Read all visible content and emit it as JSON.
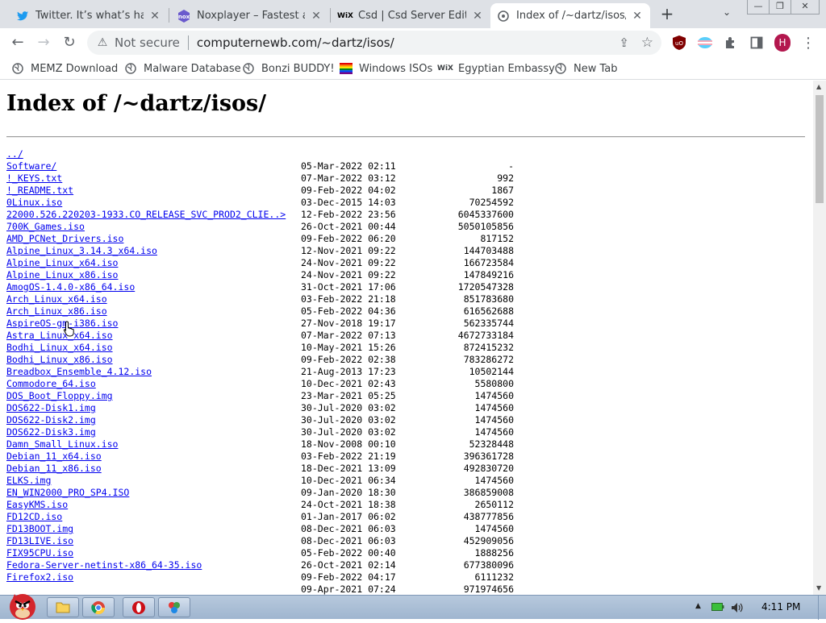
{
  "window": {
    "min_label": "—",
    "max_label": "❐",
    "close_label": "✕"
  },
  "tabs": [
    {
      "label": "Twitter. It’s what’s happening",
      "icon": "twitter-bird-icon",
      "close": "✕"
    },
    {
      "label": "Noxplayer – Fastest and",
      "icon": "noxplayer-icon",
      "close": "✕"
    },
    {
      "label": "Csd | Csd Server Edition",
      "icon": "wix-icon",
      "close": "✕"
    },
    {
      "label": "Index of /~dartz/isos/",
      "icon": "page-icon",
      "close": "✕"
    }
  ],
  "tabstrip": {
    "new_tab": "+",
    "menu": "⌄"
  },
  "toolbar": {
    "back": "←",
    "forward": "→",
    "reload": "↻",
    "security_icon": "⚠",
    "security_text": "Not secure",
    "url": "computernewb.com/~dartz/isos/",
    "share": "⇪",
    "star": "☆",
    "profile_letter": "H",
    "menu": "⋮"
  },
  "bookmarks": [
    {
      "label": "MEMZ Download",
      "icon": "globe-icon"
    },
    {
      "label": "Malware Database",
      "icon": "globe-icon"
    },
    {
      "label": "Bonzi BUDDY!",
      "icon": "globe-icon"
    },
    {
      "label": "Windows ISOs",
      "icon": "rainbow-flag-icon"
    },
    {
      "label": "Egyptian Embassy",
      "icon": "wix-icon"
    },
    {
      "label": "New Tab",
      "icon": "globe-icon"
    }
  ],
  "page": {
    "title": "Index of /~dartz/isos/",
    "entries": [
      {
        "name": "../",
        "date": "",
        "size": ""
      },
      {
        "name": "Software/",
        "date": "05-Mar-2022 02:11",
        "size": "-"
      },
      {
        "name": "!_KEYS.txt",
        "date": "07-Mar-2022 03:12",
        "size": "992"
      },
      {
        "name": "!_README.txt",
        "date": "09-Feb-2022 04:02",
        "size": "1867"
      },
      {
        "name": "0Linux.iso",
        "date": "03-Dec-2015 14:03",
        "size": "70254592"
      },
      {
        "name": "22000.526.220203-1933.CO_RELEASE_SVC_PROD2_CLIE..>",
        "date": "12-Feb-2022 23:56",
        "size": "6045337600"
      },
      {
        "name": "700K_Games.iso",
        "date": "26-Oct-2021 00:44",
        "size": "5050105856"
      },
      {
        "name": "AMD_PCNet_Drivers.iso",
        "date": "09-Feb-2022 06:20",
        "size": "817152"
      },
      {
        "name": "Alpine_Linux_3.14.3_x64.iso",
        "date": "12-Nov-2021 09:22",
        "size": "144703488"
      },
      {
        "name": "Alpine_Linux_x64.iso",
        "date": "24-Nov-2021 09:22",
        "size": "166723584"
      },
      {
        "name": "Alpine_Linux_x86.iso",
        "date": "24-Nov-2021 09:22",
        "size": "147849216"
      },
      {
        "name": "AmogOS-1.4.0-x86_64.iso",
        "date": "31-Oct-2021 17:06",
        "size": "1720547328"
      },
      {
        "name": "Arch_Linux_x64.iso",
        "date": "03-Feb-2022 21:18",
        "size": "851783680"
      },
      {
        "name": "Arch_Linux_x86.iso",
        "date": "05-Feb-2022 04:36",
        "size": "616562688"
      },
      {
        "name": "AspireOS-gm-i386.iso",
        "date": "27-Nov-2018 19:17",
        "size": "562335744"
      },
      {
        "name": "Astra_Linux_x64.iso",
        "date": "07-Mar-2022 07:13",
        "size": "4672733184"
      },
      {
        "name": "Bodhi_Linux_x64.iso",
        "date": "10-May-2021 15:26",
        "size": "872415232"
      },
      {
        "name": "Bodhi_Linux_x86.iso",
        "date": "09-Feb-2022 02:38",
        "size": "783286272"
      },
      {
        "name": "Breadbox_Ensemble_4.12.iso",
        "date": "21-Aug-2013 17:23",
        "size": "10502144"
      },
      {
        "name": "Commodore_64.iso",
        "date": "10-Dec-2021 02:43",
        "size": "5580800"
      },
      {
        "name": "DOS_Boot_Floppy.img",
        "date": "23-Mar-2021 05:25",
        "size": "1474560"
      },
      {
        "name": "DOS622-Disk1.img",
        "date": "30-Jul-2020 03:02",
        "size": "1474560"
      },
      {
        "name": "DOS622-Disk2.img",
        "date": "30-Jul-2020 03:02",
        "size": "1474560"
      },
      {
        "name": "DOS622-Disk3.img",
        "date": "30-Jul-2020 03:02",
        "size": "1474560"
      },
      {
        "name": "Damn_Small_Linux.iso",
        "date": "18-Nov-2008 00:10",
        "size": "52328448"
      },
      {
        "name": "Debian_11_x64.iso",
        "date": "03-Feb-2022 21:19",
        "size": "396361728"
      },
      {
        "name": "Debian_11_x86.iso",
        "date": "18-Dec-2021 13:09",
        "size": "492830720"
      },
      {
        "name": "ELKS.img",
        "date": "10-Dec-2021 06:34",
        "size": "1474560"
      },
      {
        "name": "EN_WIN2000_PRO_SP4.ISO",
        "date": "09-Jan-2020 18:30",
        "size": "386859008"
      },
      {
        "name": "EasyKMS.iso",
        "date": "24-Oct-2021 18:38",
        "size": "2650112"
      },
      {
        "name": "FD12CD.iso",
        "date": "01-Jan-2017 06:02",
        "size": "438777856"
      },
      {
        "name": "FD13BOOT.img",
        "date": "08-Dec-2021 06:03",
        "size": "1474560"
      },
      {
        "name": "FD13LIVE.iso",
        "date": "08-Dec-2021 06:03",
        "size": "452909056"
      },
      {
        "name": "FIX95CPU.iso",
        "date": "05-Feb-2022 00:40",
        "size": "1888256"
      },
      {
        "name": "Fedora-Server-netinst-x86_64-35.iso",
        "date": "26-Oct-2021 02:14",
        "size": "677380096"
      },
      {
        "name": "Firefox2.iso",
        "date": "09-Feb-2022 04:17",
        "size": "6111232"
      },
      {
        "name": "",
        "date": "09-Apr-2021 07:24",
        "size": "971974656"
      }
    ]
  },
  "taskbar": {
    "time": "4:11 PM",
    "items": [
      {
        "icon": "folder-icon",
        "glyph": "📁"
      },
      {
        "icon": "chrome-icon",
        "glyph": "◉"
      },
      {
        "icon": "opera-icon",
        "glyph": "O"
      },
      {
        "icon": "paint-icon",
        "glyph": "✦"
      }
    ],
    "tray_up": "▲",
    "tray_battery": "▬",
    "tray_volume": "🔈"
  },
  "colors": {
    "link": "#0000ee",
    "tabstrip": "#dee1e6",
    "taskbar": "#a9bdd6"
  }
}
